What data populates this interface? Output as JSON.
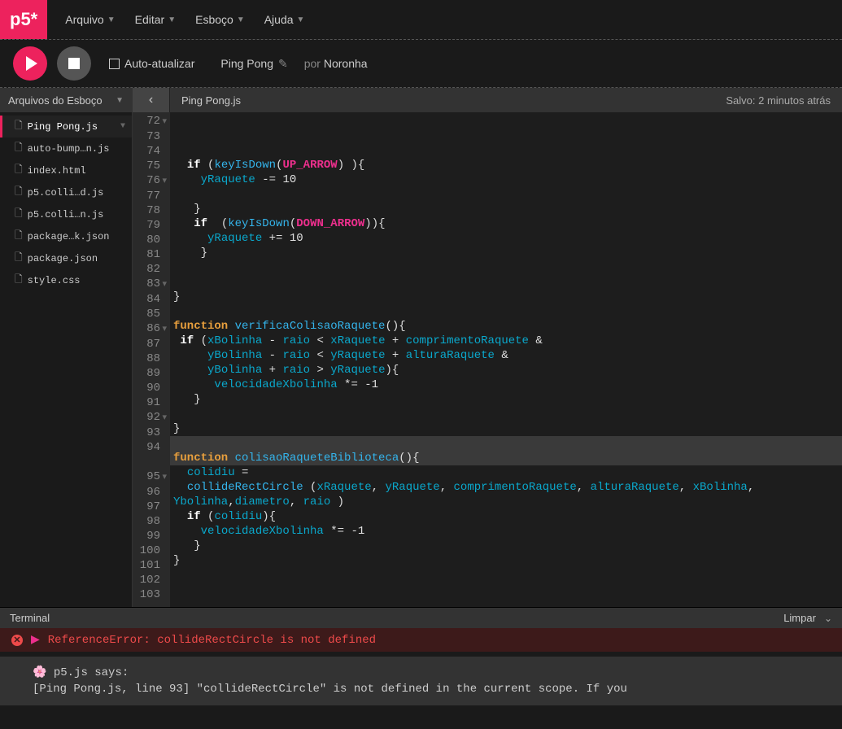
{
  "logo": "p5*",
  "menu": [
    "Arquivo",
    "Editar",
    "Esboço",
    "Ajuda"
  ],
  "toolbar": {
    "auto_refresh": "Auto-atualizar",
    "sketch_name": "Ping Pong",
    "by_label": "por",
    "author": "Noronha"
  },
  "sidebar": {
    "title": "Arquivos do Esboço",
    "files": [
      "Ping Pong.js",
      "auto-bump…n.js",
      "index.html",
      "p5.colli…d.js",
      "p5.colli…n.js",
      "package…k.json",
      "package.json",
      "style.css"
    ]
  },
  "editor": {
    "active_file": "Ping Pong.js",
    "save_status": "Salvo: 2 minutos atrás",
    "gutter_fold": "▾",
    "lines": [
      {
        "n": 72,
        "fold": true
      },
      {
        "n": 73
      },
      {
        "n": 74
      },
      {
        "n": 75
      },
      {
        "n": 76,
        "fold": true
      },
      {
        "n": 77
      },
      {
        "n": 78
      },
      {
        "n": 79
      },
      {
        "n": 80
      },
      {
        "n": 81
      },
      {
        "n": 82
      },
      {
        "n": 83,
        "fold": true
      },
      {
        "n": 84
      },
      {
        "n": 85
      },
      {
        "n": 86,
        "fold": true
      },
      {
        "n": 87
      },
      {
        "n": 88
      },
      {
        "n": 89
      },
      {
        "n": 90
      },
      {
        "n": 91
      },
      {
        "n": 92,
        "fold": true
      },
      {
        "n": 93
      },
      {
        "n": 94
      },
      {
        "n": ""
      },
      {
        "n": 95,
        "fold": true
      },
      {
        "n": 96
      },
      {
        "n": 97
      },
      {
        "n": 98
      },
      {
        "n": 99
      },
      {
        "n": 100
      },
      {
        "n": 101
      },
      {
        "n": 102
      },
      {
        "n": 103
      }
    ]
  },
  "terminal": {
    "title": "Terminal",
    "clear": "Limpar",
    "error": "ReferenceError: collideRectCircle is not defined",
    "console_prefix": "🌸 p5.js says:",
    "console_body": "[Ping Pong.js, line 93] \"collideRectCircle\" is not defined in the current scope. If you"
  }
}
